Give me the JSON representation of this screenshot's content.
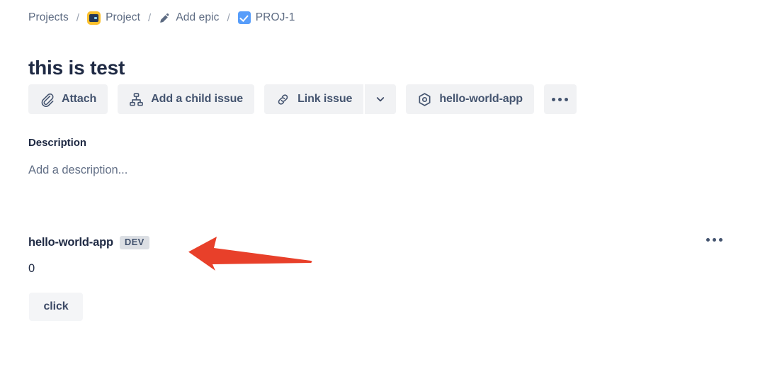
{
  "breadcrumb": {
    "items": [
      {
        "label": "Projects",
        "icon": null
      },
      {
        "label": "Project",
        "icon": "project-avatar-icon"
      },
      {
        "label": "Add epic",
        "icon": "pencil-icon"
      },
      {
        "label": "PROJ-1",
        "icon": "task-checkbox-icon"
      }
    ],
    "separator": "/"
  },
  "issue": {
    "title": "this is test"
  },
  "toolbar": {
    "attach_label": "Attach",
    "add_child_label": "Add a child issue",
    "link_issue_label": "Link issue",
    "app_label": "hello-world-app",
    "more_label": "•••"
  },
  "description": {
    "heading": "Description",
    "placeholder": "Add a description..."
  },
  "app_panel": {
    "name": "hello-world-app",
    "badge": "DEV",
    "counter": "0",
    "button_label": "click"
  },
  "colors": {
    "page_background": "#ffffff",
    "title_text": "#1f2a44",
    "breadcrumb_text": "#5d6b82",
    "button_background": "#f1f2f4",
    "button_text": "#44546f",
    "project_icon_yellow": "#fbc02d",
    "task_icon_blue": "#579dfa",
    "badge_background": "#dcdfe4",
    "annotation_arrow": "#e8402a"
  }
}
